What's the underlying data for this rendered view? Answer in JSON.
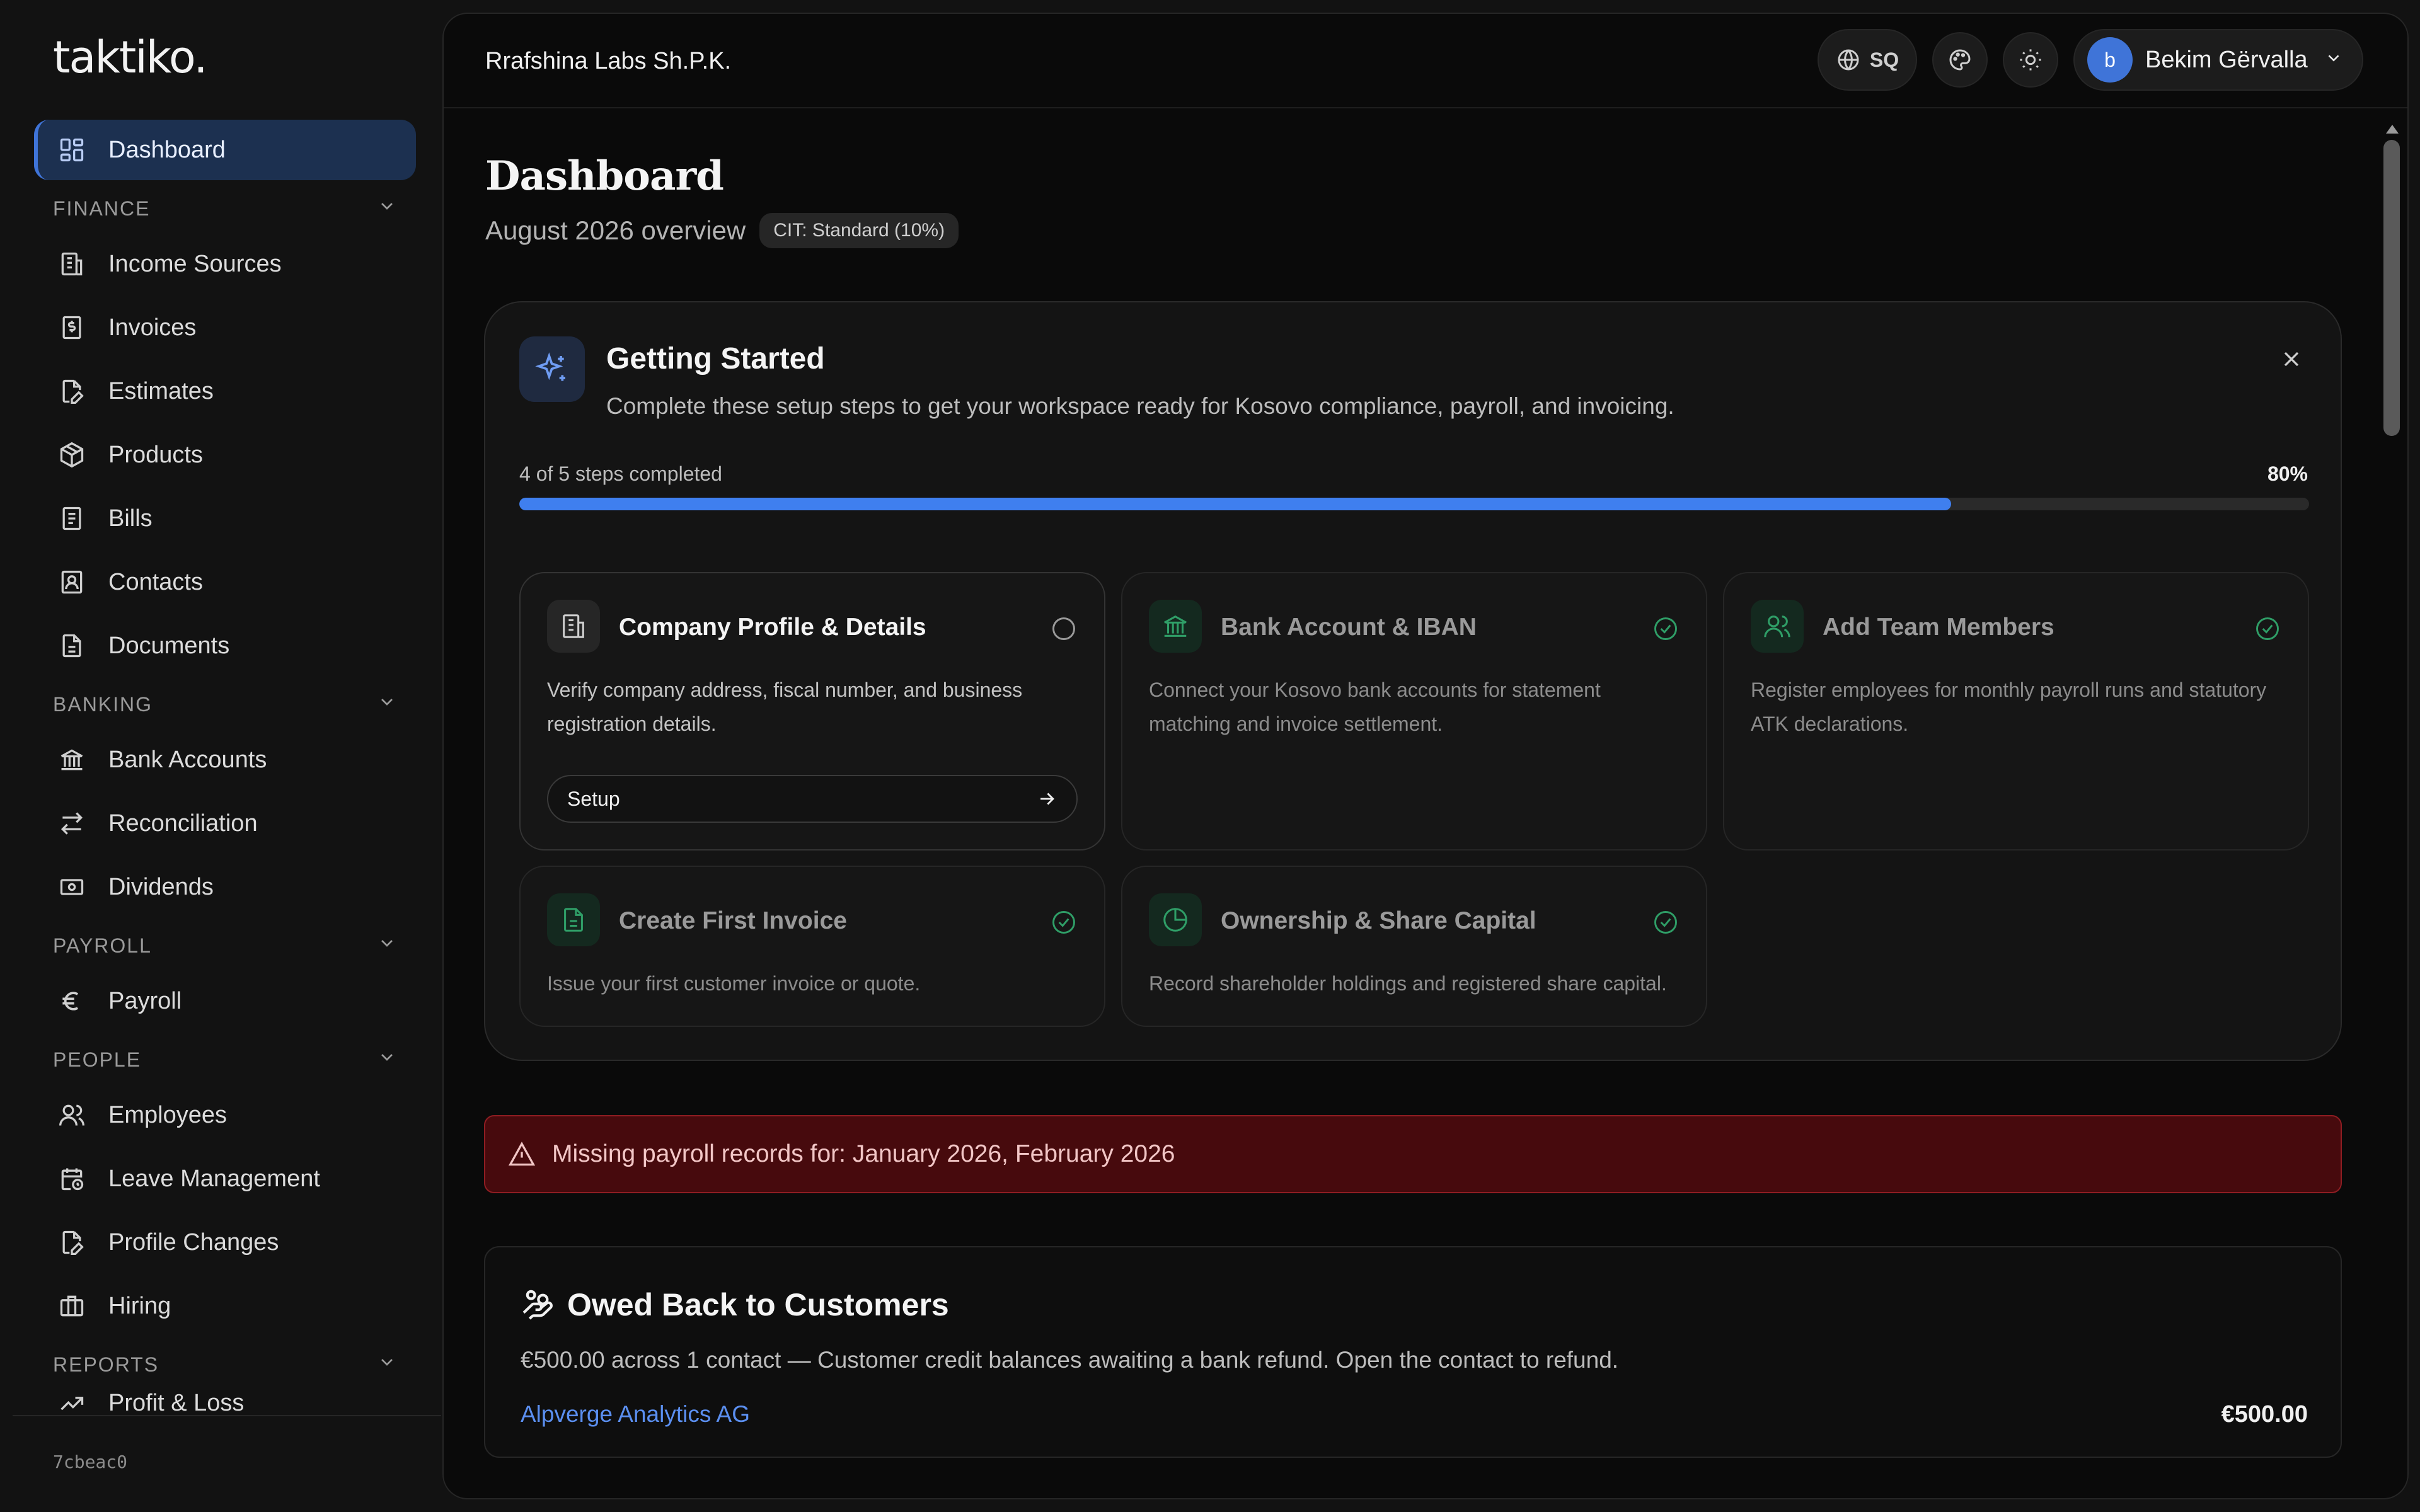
{
  "app": {
    "logo": "taktiko."
  },
  "sidebar": {
    "dashboard": {
      "label": "Dashboard"
    },
    "sections": {
      "finance": {
        "title": "FINANCE",
        "items": [
          "Income Sources",
          "Invoices",
          "Estimates",
          "Products",
          "Bills",
          "Contacts",
          "Documents"
        ]
      },
      "banking": {
        "title": "BANKING",
        "items": [
          "Bank Accounts",
          "Reconciliation",
          "Dividends"
        ]
      },
      "payroll": {
        "title": "PAYROLL",
        "items": [
          "Payroll"
        ]
      },
      "people": {
        "title": "PEOPLE",
        "items": [
          "Employees",
          "Leave Management",
          "Profile Changes",
          "Hiring"
        ]
      },
      "reports": {
        "title": "REPORTS",
        "items": [
          "Profit & Loss"
        ]
      }
    },
    "version": "7cbeac0"
  },
  "header": {
    "org_name": "Rrafshina Labs Sh.P.K.",
    "language": "SQ",
    "user": {
      "initial": "b",
      "name": "Bekim Gërvalla"
    }
  },
  "page": {
    "title": "Dashboard",
    "subtitle": "August 2026 overview",
    "badge": "CIT: Standard (10%)"
  },
  "getting_started": {
    "title": "Getting Started",
    "description": "Complete these setup steps to get your workspace ready for Kosovo compliance, payroll, and invoicing.",
    "progress_label": "4 of 5 steps completed",
    "progress_percent_label": "80%",
    "progress_fraction": 0.8,
    "steps": [
      {
        "title": "Company Profile & Details",
        "description": "Verify company address, fiscal number, and business registration details.",
        "status": "pending",
        "button": "Setup",
        "icon": "building-icon"
      },
      {
        "title": "Bank Account & IBAN",
        "description": "Connect your Kosovo bank accounts for statement matching and invoice settlement.",
        "status": "done",
        "icon": "bank-icon"
      },
      {
        "title": "Add Team Members",
        "description": "Register employees for monthly payroll runs and statutory ATK declarations.",
        "status": "done",
        "icon": "users-icon"
      },
      {
        "title": "Create First Invoice",
        "description": "Issue your first customer invoice or quote.",
        "status": "done",
        "icon": "file-icon"
      },
      {
        "title": "Ownership & Share Capital",
        "description": "Record shareholder holdings and registered share capital.",
        "status": "done",
        "icon": "pie-chart-icon"
      }
    ]
  },
  "alert": {
    "message": "Missing payroll records for: January 2026, February 2026"
  },
  "owed": {
    "title": "Owed Back to Customers",
    "description": "€500.00 across 1 contact — Customer credit balances awaiting a bank refund. Open the contact to refund.",
    "contact": "Alpverge Analytics AG",
    "amount": "€500.00"
  },
  "colors": {
    "accent": "#3f7fef",
    "success": "#2f9e67",
    "alert_bg": "#470a0d",
    "link": "#5b8ff0"
  }
}
